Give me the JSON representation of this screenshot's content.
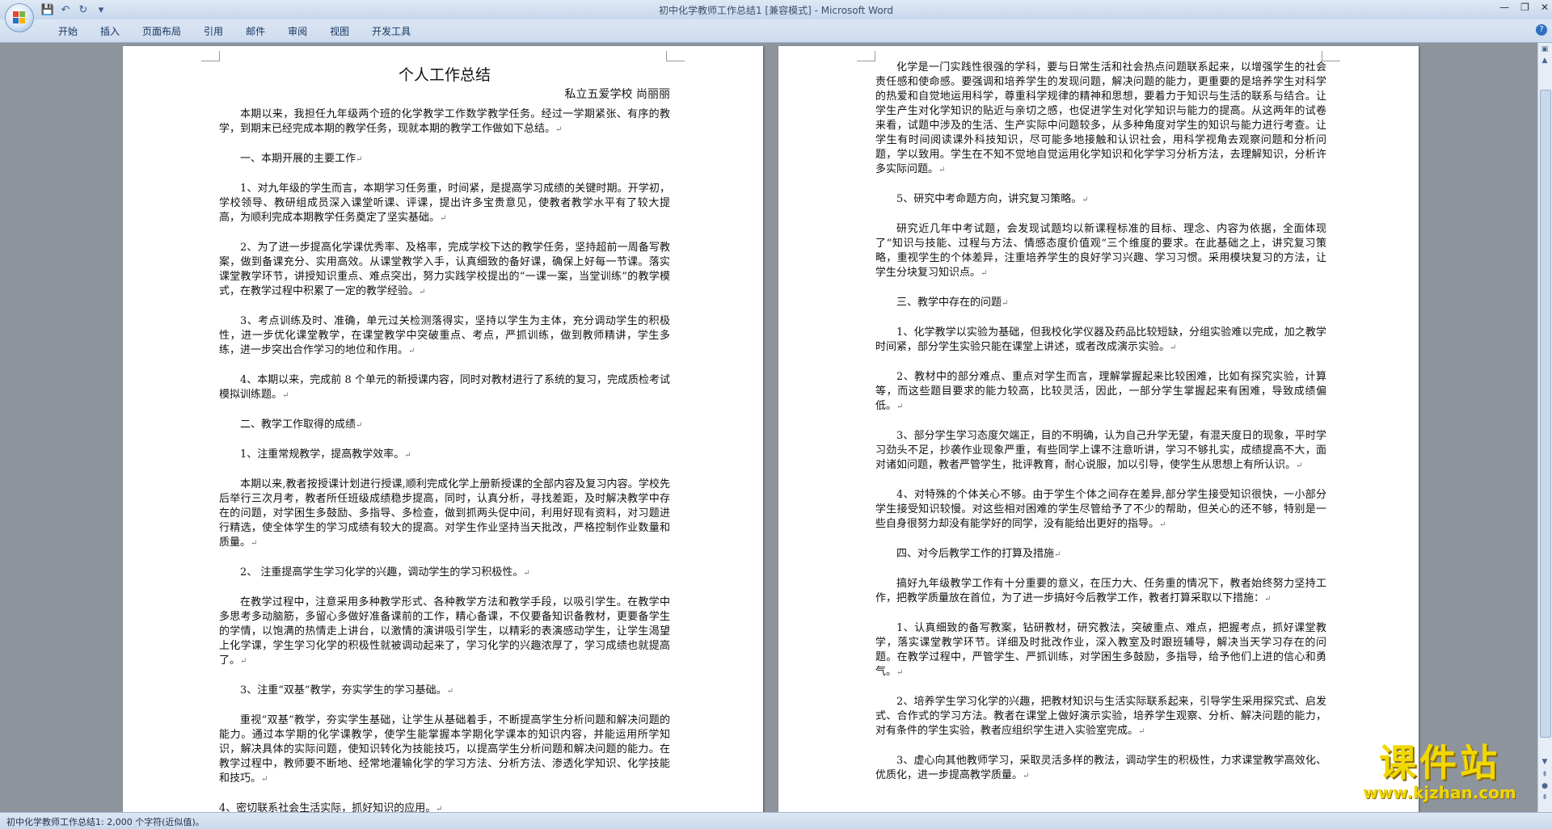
{
  "window": {
    "title": "初中化学教师工作总结1 [兼容模式] - Microsoft Word"
  },
  "ribbon": {
    "tabs": [
      "开始",
      "插入",
      "页面布局",
      "引用",
      "邮件",
      "审阅",
      "视图",
      "开发工具"
    ]
  },
  "document": {
    "title": "个人工作总结",
    "author": "私立五爱学校  尚丽丽",
    "left_paragraphs": [
      {
        "type": "p",
        "text": "本期以来，我担任九年级两个班的化学教学工作数学教学任务。经过一学期紧张、有序的教学，到期末已经完成本期的教学任务，现就本期的教学工作做如下总结。"
      },
      {
        "type": "h",
        "text": "一、本期开展的主要工作"
      },
      {
        "type": "p",
        "text": "1、对九年级的学生而言，本期学习任务重，时间紧，是提高学习成绩的关键时期。开学初，学校领导、教研组成员深入课堂听课、评课，提出许多宝贵意见，使教者教学水平有了较大提高，为顺利完成本期教学任务奠定了坚实基础。"
      },
      {
        "type": "p",
        "text": "2、为了进一步提高化学课优秀率、及格率，完成学校下达的教学任务，坚持超前一周备写教案，做到备课充分、实用高效。从课堂教学入手，认真细致的备好课，确保上好每一节课。落实课堂教学环节，讲授知识重点、难点突出，努力实践学校提出的“一课一案，当堂训练”的教学模式，在教学过程中积累了一定的教学经验。"
      },
      {
        "type": "p",
        "text": "3、考点训练及时、准确，单元过关检测落得实，坚持以学生为主体，充分调动学生的积极性，进一步优化课堂教学，在课堂教学中突破重点、考点，严抓训练，做到教师精讲，学生多练，进一步突出合作学习的地位和作用。"
      },
      {
        "type": "p",
        "text": "4、本期以来，完成前 8 个单元的新授课内容，同时对教材进行了系统的复习，完成质检考试模拟训练题。"
      },
      {
        "type": "h",
        "text": "二、教学工作取得的成绩"
      },
      {
        "type": "h",
        "text": "1、注重常规教学，提高教学效率。"
      },
      {
        "type": "p",
        "text": "本期以来,教者按授课计划进行授课,顺利完成化学上册新授课的全部内容及复习内容。学校先后举行三次月考，教者所任班级成绩稳步提高，同时，认真分析，寻找差距，及时解决教学中存在的问题，对学困生多鼓励、多指导、多检查，做到抓两头促中间，利用好现有资料，对习题进行精选，使全体学生的学习成绩有较大的提高。对学生作业坚持当天批改，严格控制作业数量和质量。"
      },
      {
        "type": "h",
        "text": "2、  注重提高学生学习化学的兴趣，调动学生的学习积极性。"
      },
      {
        "type": "p",
        "text": "在教学过程中，注意采用多种教学形式、各种教学方法和教学手段，以吸引学生。在教学中多思考多动脑筋，多留心多做好准备课前的工作，精心备课，不仅要备知识备教材，更要备学生的学情，以饱满的热情走上讲台，以激情的演讲吸引学生，以精彩的表演感动学生，让学生渴望上化学课，学生学习化学的积极性就被调动起来了，学习化学的兴趣浓厚了，学习成绩也就提高了。"
      },
      {
        "type": "h",
        "text": "3、注重“双基”教学，夯实学生的学习基础。"
      },
      {
        "type": "p",
        "text": "重视“双基”教学，夯实学生基础，让学生从基础着手，不断提高学生分析问题和解决问题的能力。通过本学期的化学课教学，使学生能掌握本学期化学课本的知识内容，并能运用所学知识，解决具体的实际问题，使知识转化为技能技巧，以提高学生分析问题和解决问题的能力。在教学过程中，教师要不断地、经常地灌输化学的学习方法、分析方法、渗透化学知识、化学技能和技巧。"
      },
      {
        "type": "plain",
        "text": "4、密切联系社会生活实际，抓好知识的应用。"
      }
    ],
    "right_paragraphs": [
      {
        "type": "p",
        "text": "化学是一门实践性很强的学科，要与日常生活和社会热点问题联系起来，以增强学生的社会责任感和使命感。要强调和培养学生的发现问题，解决问题的能力，更重要的是培养学生对科学的热爱和自觉地运用科学，尊重科学规律的精神和思想，要着力于知识与生活的联系与结合。让学生产生对化学知识的贴近与亲切之感，也促进学生对化学知识与能力的提高。从这两年的试卷来看，试题中涉及的生活、生产实际中问题较多，从多种角度对学生的知识与能力进行考查。让学生有时间阅读课外科技知识，尽可能多地接触和认识社会，用科学视角去观察问题和分析问题，学以致用。学生在不知不觉地自觉运用化学知识和化学学习分析方法，去理解知识，分析许多实际问题。"
      },
      {
        "type": "h",
        "text": "5、研究中考命题方向，讲究复习策略。"
      },
      {
        "type": "p",
        "text": "研究近几年中考试题，会发现试题均以新课程标准的目标、理念、内容为依据，全面体现了“知识与技能、过程与方法、情感态度价值观“三个维度的要求。在此基础之上，讲究复习策略，重视学生的个体差异，注重培养学生的良好学习兴趣、学习习惯。采用模块复习的方法，让学生分块复习知识点。"
      },
      {
        "type": "h",
        "text": "三、教学中存在的问题"
      },
      {
        "type": "p",
        "text": "1、化学教学以实验为基础，但我校化学仪器及药品比较短缺，分组实验难以完成，加之教学时间紧，部分学生实验只能在课堂上讲述，或者改成演示实验。"
      },
      {
        "type": "p",
        "text": "2、教材中的部分难点、重点对学生而言，理解掌握起来比较困难，比如有探究实验，计算等，而这些题目要求的能力较高，比较灵活，因此，一部分学生掌握起来有困难，导致成绩偏低。"
      },
      {
        "type": "p",
        "text": "3、部分学生学习态度欠端正，目的不明确，认为自己升学无望，有混天度日的现象，平时学习劲头不足，抄袭作业现象严重，有些同学上课不注意听讲，学习不够扎实，成绩提高不大，面对诸如问题，教者严管学生，批评教育，耐心说服，加以引导，使学生从思想上有所认识。"
      },
      {
        "type": "p",
        "text": "4、对特殊的个体关心不够。由于学生个体之间存在差异,部分学生接受知识很快，一小部分学生接受知识较慢。对这些相对困难的学生尽管给予了不少的帮助，但关心的还不够，特别是一些自身很努力却没有能学好的同学，没有能给出更好的指导。"
      },
      {
        "type": "h",
        "text": "四、对今后教学工作的打算及措施"
      },
      {
        "type": "p",
        "text": "搞好九年级教学工作有十分重要的意义，在压力大、任务重的情况下，教者始终努力坚持工作，把教学质量放在首位，为了进一步搞好今后教学工作，教者打算采取以下措施："
      },
      {
        "type": "p",
        "text": "1、认真细致的备写教案，钻研教材，研究教法，突破重点、难点，把握考点，抓好课堂教学，落实课堂教学环节。详细及时批改作业，深入教室及时跟班辅导，解决当天学习存在的问题。在教学过程中，严管学生、严抓训练，对学困生多鼓励，多指导，给予他们上进的信心和勇气。"
      },
      {
        "type": "p",
        "text": "2、培养学生学习化学的兴趣，把教材知识与生活实际联系起来，引导学生采用探究式、启发式、合作式的学习方法。教者在课堂上做好演示实验，培养学生观察、分析、解决问题的能力，对有条件的学生实验，教者应组织学生进入实验室完成。"
      },
      {
        "type": "p",
        "text": "3、虚心向其他教师学习，采取灵活多样的教法，调动学生的积极性，力求课堂教学高效化、优质化，进一步提高教学质量。"
      }
    ]
  },
  "statusbar": {
    "text": "初中化学教师工作总结1: 2,000 个字符(近似值)。"
  },
  "watermark": {
    "title": "课件站",
    "url": "www.kjzhan.com"
  },
  "colors": {
    "office_blue": "#2f6fc1",
    "workspace": "#8e949c",
    "watermark_yellow": "#f0d800"
  }
}
